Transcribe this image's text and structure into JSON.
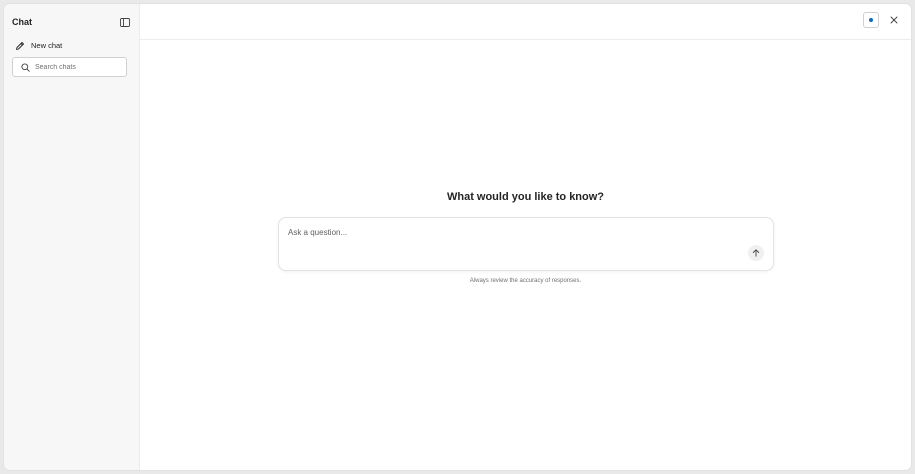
{
  "sidebar": {
    "title": "Chat",
    "new_chat_label": "New chat",
    "search_placeholder": "Search chats",
    "icons": {
      "collapse": "sidebar-collapse-icon",
      "new_chat": "pencil-icon",
      "search": "search-icon"
    }
  },
  "topbar": {
    "icons": {
      "status": "status-dot-icon",
      "close": "close-icon"
    },
    "status_color": "#0f6cbd"
  },
  "main": {
    "headline": "What would you like to know?",
    "composer_placeholder": "Ask a question...",
    "disclaimer": "Always review the accuracy of responses.",
    "icons": {
      "send": "arrow-up-icon"
    }
  }
}
